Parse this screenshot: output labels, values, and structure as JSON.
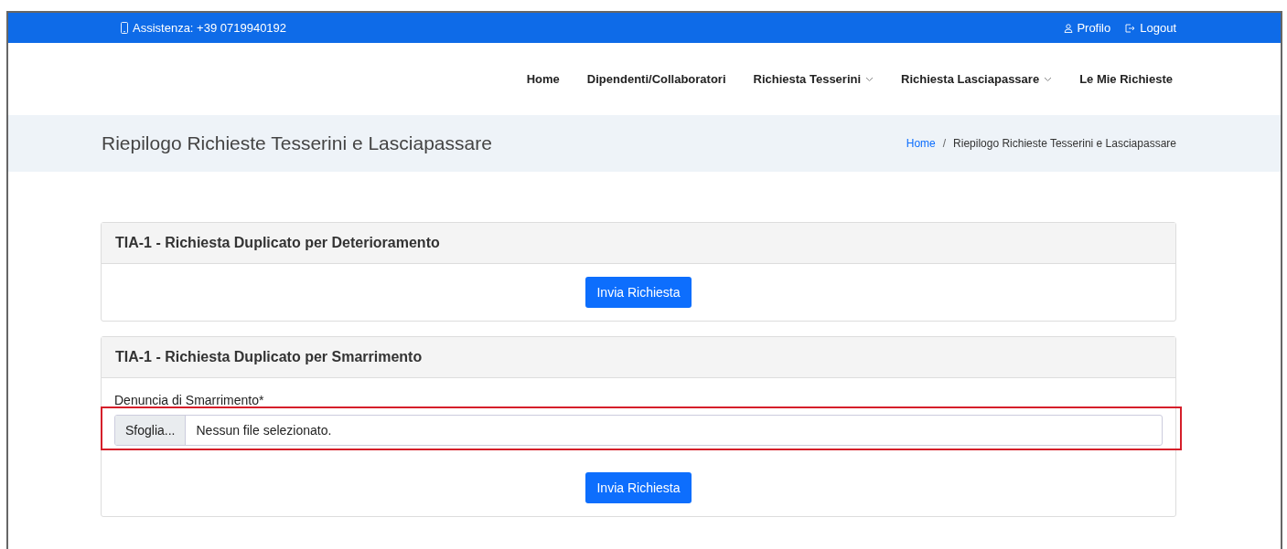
{
  "top_bar": {
    "support": "Assistenza: +39 0719940192",
    "links": [
      {
        "label": "Profilo",
        "kind": "profile"
      },
      {
        "label": "Logout",
        "kind": "logout"
      }
    ]
  },
  "nav": [
    {
      "label": "Home",
      "dropdown": false
    },
    {
      "label": "Dipendenti/Collaboratori",
      "dropdown": false
    },
    {
      "label": "Richiesta Tesserini",
      "dropdown": true
    },
    {
      "label": "Richiesta Lasciapassare",
      "dropdown": true
    },
    {
      "label": "Le Mie Richieste",
      "dropdown": false
    }
  ],
  "page_title": "Riepilogo Richieste Tesserini e Lasciapassare",
  "breadcrumb_separator": "/",
  "breadcrumb": [
    {
      "label": "Home",
      "kind": "link"
    },
    {
      "label": "Riepilogo Richieste Tesserini e Lasciapassare",
      "kind": "current"
    }
  ],
  "cards": [
    {
      "title": "TIA-1 - Richiesta Duplicato per Deterioramento",
      "button": "Invia Richiesta"
    },
    {
      "title": "TIA-1 - Richiesta Duplicato per Smarrimento",
      "field": {
        "label": "Denuncia di Smarrimento*",
        "button": "Sfoglia...",
        "value": "Nessun file selezionato.",
        "highlighted": true
      },
      "button": "Invia Richiesta"
    }
  ]
}
